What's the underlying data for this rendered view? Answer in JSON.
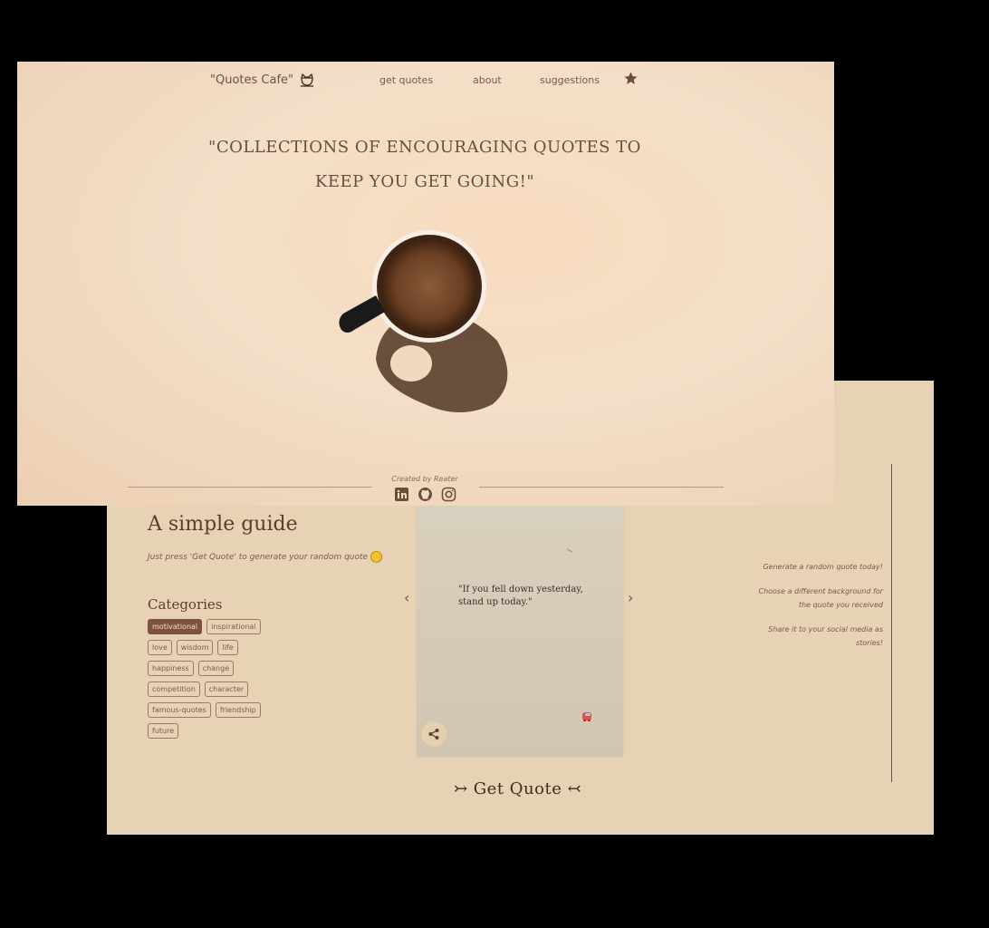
{
  "nav": {
    "brand": "\"Quotes Cafe\"",
    "links": [
      "get quotes",
      "about",
      "suggestions"
    ]
  },
  "hero": {
    "title": "\"COLLECTIONS OF ENCOURAGING QUOTES TO KEEP YOU GET GOING!\""
  },
  "footer": {
    "credit": "Created by Reater"
  },
  "guide": {
    "title": "A simple guide",
    "subtitle": "Just press 'Get Quote' to generate your random quote"
  },
  "categories": {
    "title": "Categories",
    "rows": [
      [
        "motivational",
        "inspirational"
      ],
      [
        "love",
        "wisdom",
        "life"
      ],
      [
        "happiness",
        "change"
      ],
      [
        "competition",
        "character"
      ],
      [
        "famous-quotes",
        "friendship"
      ],
      [
        "future"
      ]
    ],
    "active": "motivational"
  },
  "card": {
    "quote": "\"If you fell down yesterday, stand up today.\""
  },
  "get_quote": "↣ Get Quote ↢",
  "steps": [
    "Generate a random quote today!",
    "Choose a different background for the quote you received",
    "Share it to your social media as stories!"
  ],
  "colors": {
    "accent": "#7d5241",
    "background": "#e8d2b5",
    "hero": "#f3dec7"
  }
}
